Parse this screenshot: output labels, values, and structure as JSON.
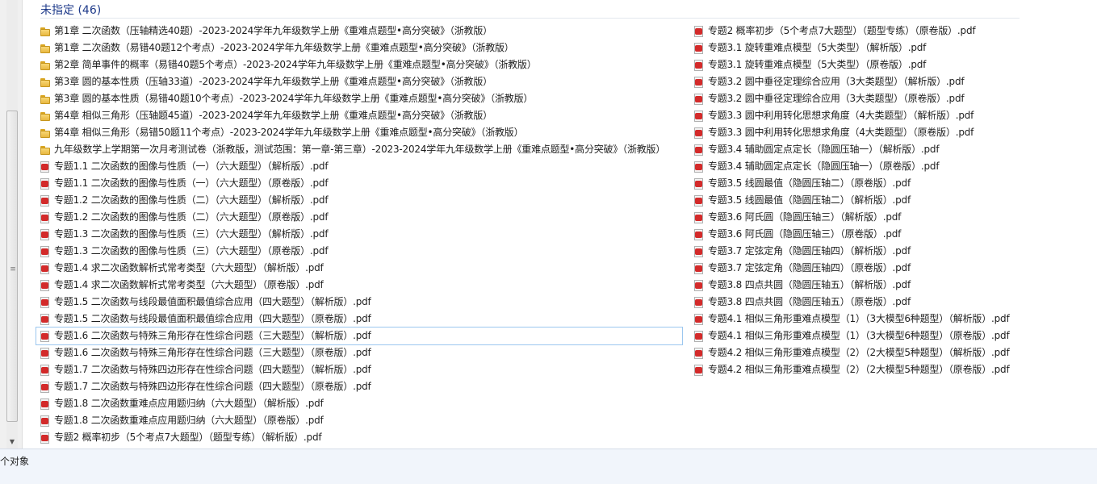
{
  "group": {
    "title": "未指定 (46)"
  },
  "status": {
    "text": "个对象"
  },
  "left_items": [
    {
      "type": "folder",
      "label": "第1章 二次函数（压轴精选40题）-2023-2024学年九年级数学上册《重难点题型•高分突破》（浙教版）"
    },
    {
      "type": "folder",
      "label": "第1章 二次函数（易错40题12个考点）-2023-2024学年九年级数学上册《重难点题型•高分突破》（浙教版）"
    },
    {
      "type": "folder",
      "label": "第2章 简单事件的概率（易错40题5个考点）-2023-2024学年九年级数学上册《重难点题型•高分突破》（浙教版）"
    },
    {
      "type": "folder",
      "label": "第3章 圆的基本性质（压轴33道）-2023-2024学年九年级数学上册《重难点题型•高分突破》（浙教版）"
    },
    {
      "type": "folder",
      "label": "第3章 圆的基本性质（易错40题10个考点）-2023-2024学年九年级数学上册《重难点题型•高分突破》（浙教版）"
    },
    {
      "type": "folder",
      "label": "第4章 相似三角形（压轴题45道）-2023-2024学年九年级数学上册《重难点题型•高分突破》（浙教版）"
    },
    {
      "type": "folder",
      "label": "第4章 相似三角形（易错50题11个考点）-2023-2024学年九年级数学上册《重难点题型•高分突破》（浙教版）"
    },
    {
      "type": "folder",
      "label": "九年级数学上学期第一次月考测试卷（浙教版，测试范围：第一章-第三章）-2023-2024学年九年级数学上册《重难点题型•高分突破》（浙教版）"
    },
    {
      "type": "pdf",
      "label": "专题1.1 二次函数的图像与性质（一）（六大题型）（解析版）.pdf"
    },
    {
      "type": "pdf",
      "label": "专题1.1 二次函数的图像与性质（一）（六大题型）（原卷版）.pdf"
    },
    {
      "type": "pdf",
      "label": "专题1.2 二次函数的图像与性质（二）（六大题型）（解析版）.pdf"
    },
    {
      "type": "pdf",
      "label": "专题1.2 二次函数的图像与性质（二）（六大题型）（原卷版）.pdf"
    },
    {
      "type": "pdf",
      "label": "专题1.3 二次函数的图像与性质（三）（六大题型）（解析版）.pdf"
    },
    {
      "type": "pdf",
      "label": "专题1.3 二次函数的图像与性质（三）（六大题型）（原卷版）.pdf"
    },
    {
      "type": "pdf",
      "label": "专题1.4  求二次函数解析式常考类型（六大题型）（解析版）.pdf"
    },
    {
      "type": "pdf",
      "label": "专题1.4  求二次函数解析式常考类型（六大题型）（原卷版）.pdf"
    },
    {
      "type": "pdf",
      "label": "专题1.5  二次函数与线段最值面积最值综合应用（四大题型）（解析版）.pdf"
    },
    {
      "type": "pdf",
      "label": "专题1.5  二次函数与线段最值面积最值综合应用（四大题型）（原卷版）.pdf"
    },
    {
      "type": "pdf",
      "label": "专题1.6 二次函数与特殊三角形存在性综合问题（三大题型）（解析版）.pdf"
    },
    {
      "type": "pdf",
      "label": "专题1.6 二次函数与特殊三角形存在性综合问题（三大题型）（原卷版）.pdf"
    },
    {
      "type": "pdf",
      "label": "专题1.7 二次函数与特殊四边形存在性综合问题（四大题型）（解析版）.pdf"
    },
    {
      "type": "pdf",
      "label": "专题1.7 二次函数与特殊四边形存在性综合问题（四大题型）（原卷版）.pdf"
    },
    {
      "type": "pdf",
      "label": "专题1.8 二次函数重难点应用题归纳（六大题型）（解析版）.pdf"
    },
    {
      "type": "pdf",
      "label": "专题1.8 二次函数重难点应用题归纳（六大题型）（原卷版）.pdf"
    },
    {
      "type": "pdf",
      "label": "专题2 概率初步（5个考点7大题型）（题型专练）（解析版）.pdf"
    }
  ],
  "right_items": [
    {
      "type": "pdf",
      "label": "专题2 概率初步（5个考点7大题型）（题型专练）（原卷版）.pdf"
    },
    {
      "type": "pdf",
      "label": "专题3.1 旋转重难点模型（5大类型）（解析版）.pdf"
    },
    {
      "type": "pdf",
      "label": "专题3.1 旋转重难点模型（5大类型）（原卷版）.pdf"
    },
    {
      "type": "pdf",
      "label": "专题3.2 圆中垂径定理综合应用（3大类题型）（解析版）.pdf"
    },
    {
      "type": "pdf",
      "label": "专题3.2 圆中垂径定理综合应用（3大类题型）（原卷版）.pdf"
    },
    {
      "type": "pdf",
      "label": "专题3.3 圆中利用转化思想求角度（4大类题型）（解析版）.pdf"
    },
    {
      "type": "pdf",
      "label": "专题3.3 圆中利用转化思想求角度（4大类题型）（原卷版）.pdf"
    },
    {
      "type": "pdf",
      "label": "专题3.4 辅助圆定点定长（隐圆压轴一）（解析版）.pdf"
    },
    {
      "type": "pdf",
      "label": "专题3.4 辅助圆定点定长（隐圆压轴一）（原卷版）.pdf"
    },
    {
      "type": "pdf",
      "label": "专题3.5 线圆最值（隐圆压轴二）（原卷版）.pdf"
    },
    {
      "type": "pdf",
      "label": "专题3.5 线圆最值（隐圆压轴二）（解析版）.pdf"
    },
    {
      "type": "pdf",
      "label": "专题3.6 阿氏圆（隐圆压轴三）（解析版）.pdf"
    },
    {
      "type": "pdf",
      "label": "专题3.6 阿氏圆（隐圆压轴三）（原卷版）.pdf"
    },
    {
      "type": "pdf",
      "label": "专题3.7 定弦定角（隐圆压轴四）（解析版）.pdf"
    },
    {
      "type": "pdf",
      "label": "专题3.7 定弦定角（隐圆压轴四）（原卷版）.pdf"
    },
    {
      "type": "pdf",
      "label": "专题3.8 四点共圆（隐圆压轴五）（解析版）.pdf"
    },
    {
      "type": "pdf",
      "label": "专题3.8 四点共圆（隐圆压轴五）（原卷版）.pdf"
    },
    {
      "type": "pdf",
      "label": "专题4.1 相似三角形重难点模型（1）（3大模型6种题型）（解析版）.pdf"
    },
    {
      "type": "pdf",
      "label": "专题4.1 相似三角形重难点模型（1）（3大模型6种题型）（原卷版）.pdf"
    },
    {
      "type": "pdf",
      "label": "专题4.2 相似三角形重难点模型（2）（2大模型5种题型）（解析版）.pdf"
    },
    {
      "type": "pdf",
      "label": "专题4.2 相似三角形重难点模型（2）（2大模型5种题型）（原卷版）.pdf"
    }
  ]
}
